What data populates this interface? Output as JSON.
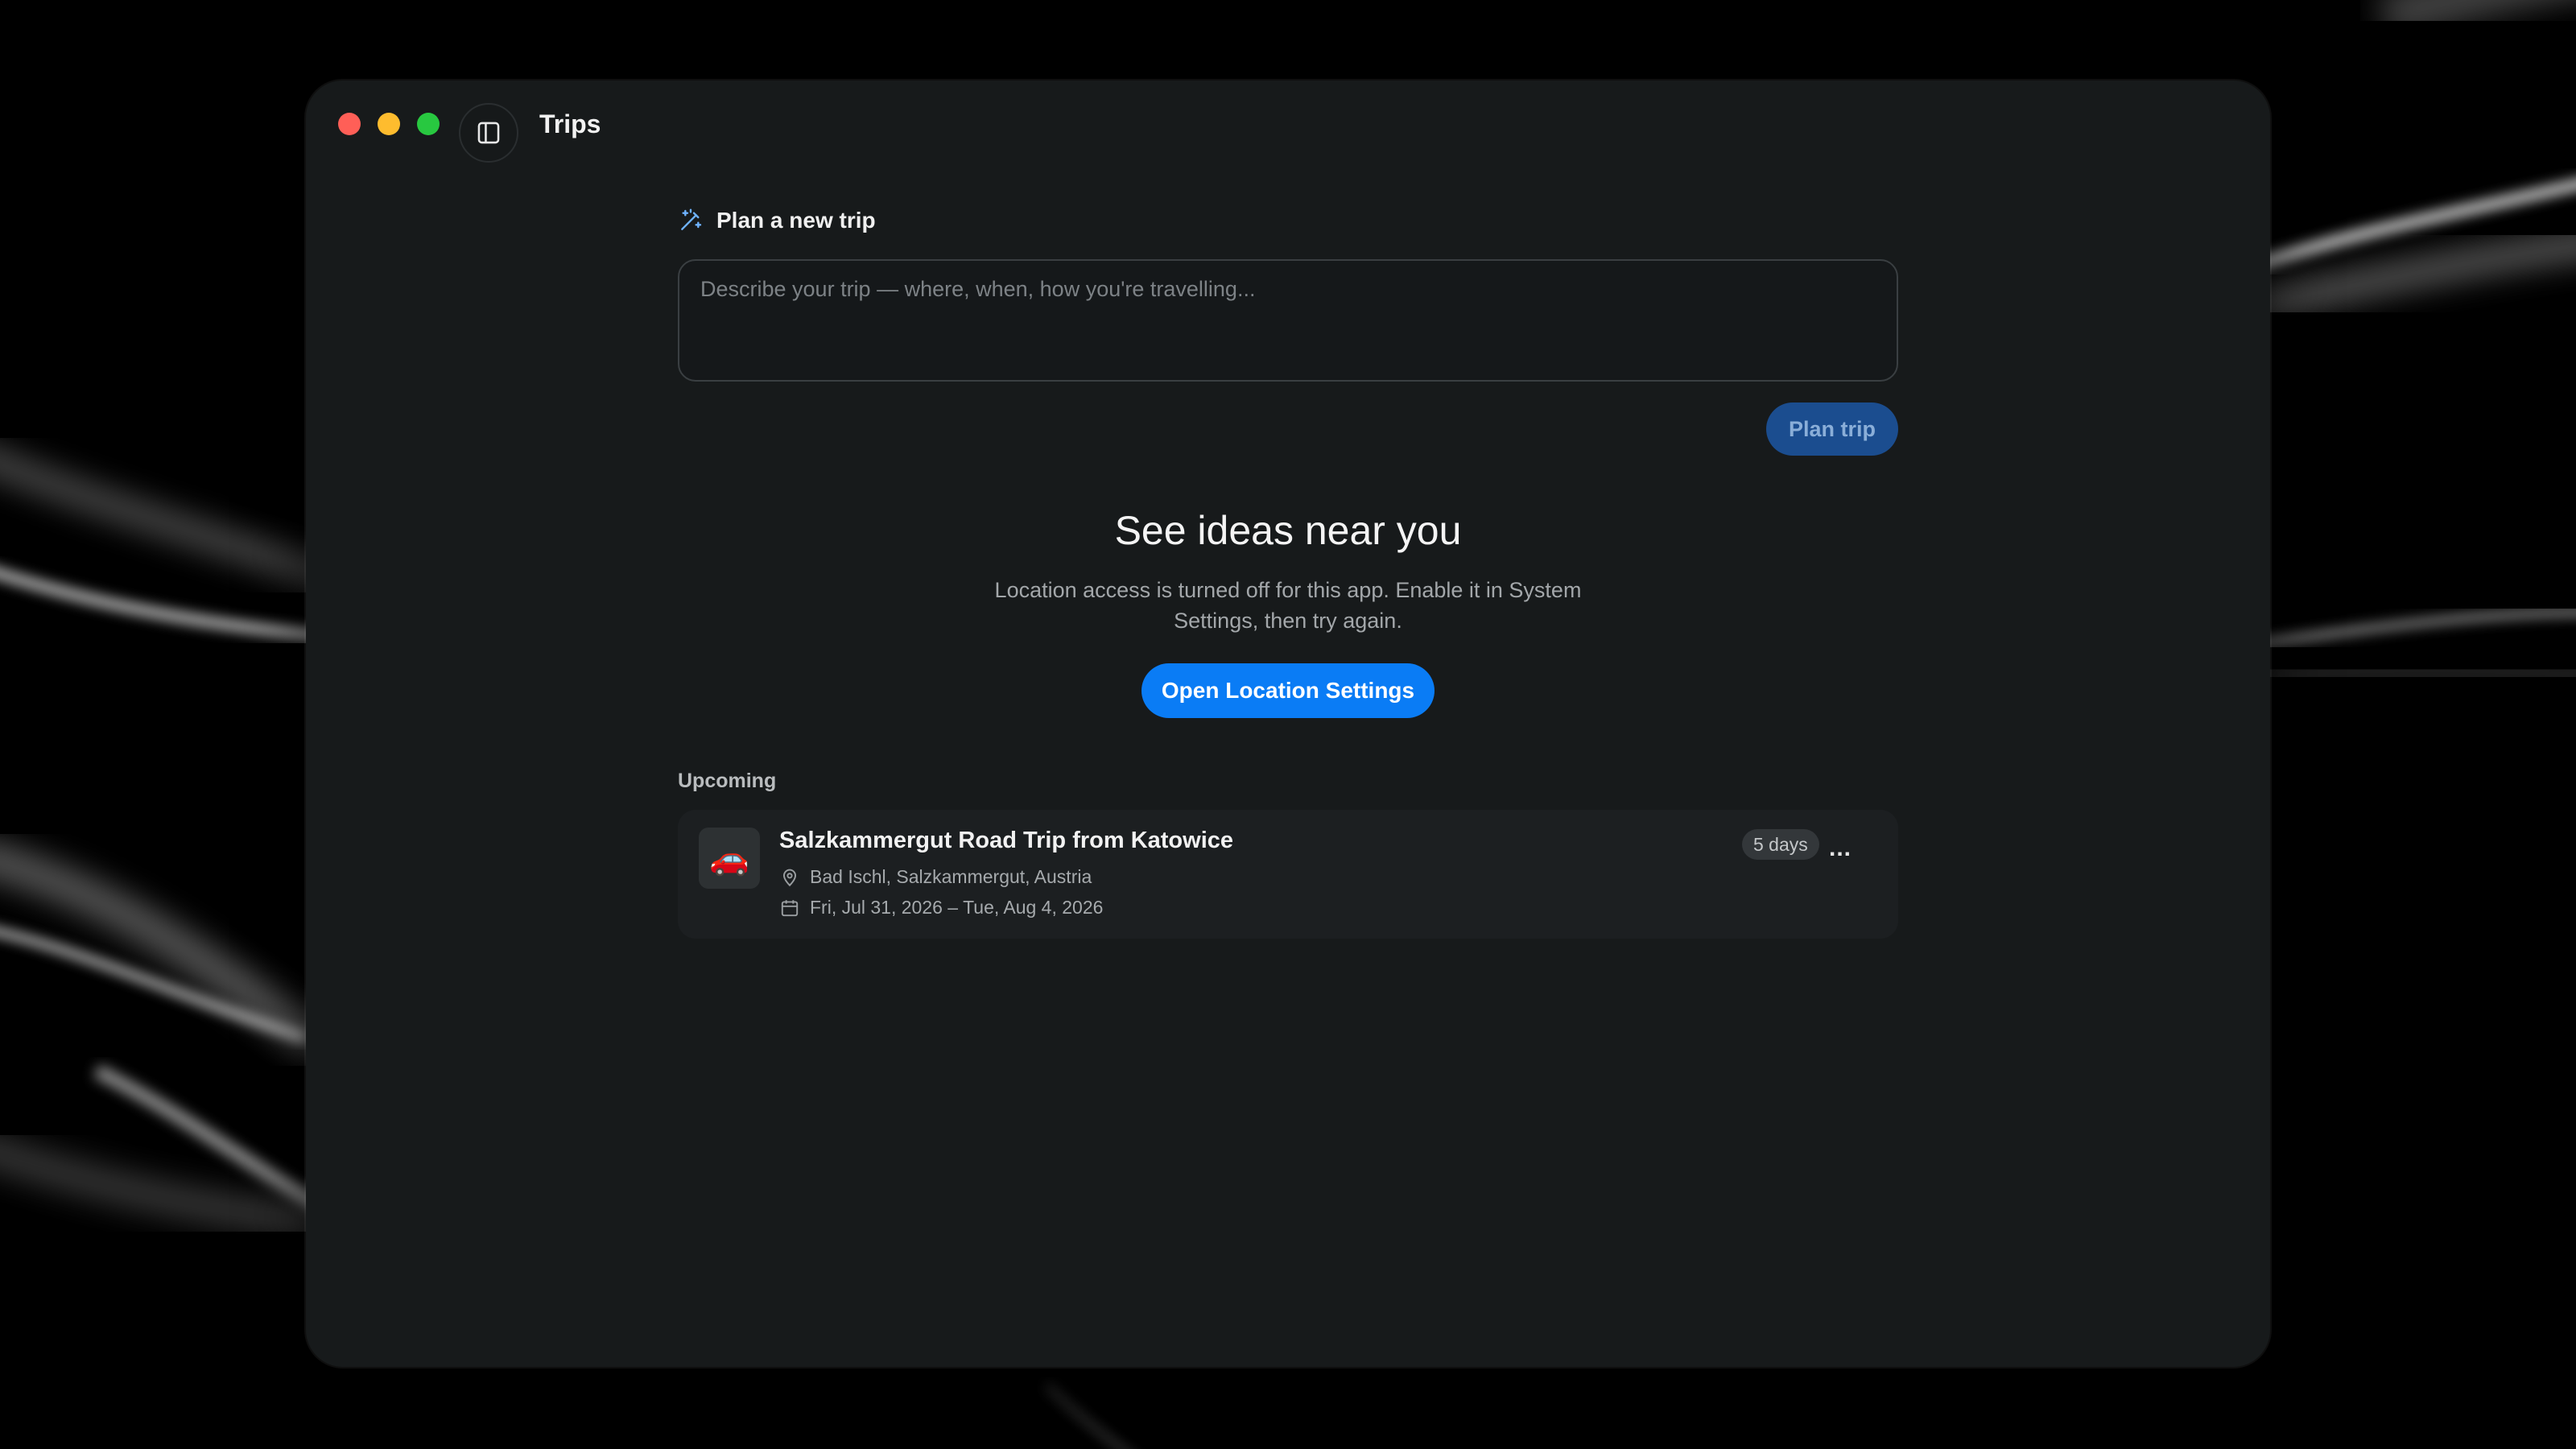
{
  "window": {
    "title": "Trips"
  },
  "plan": {
    "header_label": "Plan a new trip",
    "input_value": "",
    "input_placeholder": "Describe your trip — where, when, how you're travelling...",
    "button_label": "Plan trip"
  },
  "ideas": {
    "title": "See ideas near you",
    "description": "Location access is turned off for this app. Enable it in System Settings, then try again.",
    "button_label": "Open Location Settings"
  },
  "upcoming": {
    "section_label": "Upcoming",
    "trips": [
      {
        "emoji": "🚗",
        "title": "Salzkammergut Road Trip from Katowice",
        "location": "Bad Ischl, Salzkammergut, Austria",
        "dates": "Fri, Jul 31, 2026 – Tue, Aug 4, 2026",
        "duration_badge": "5 days",
        "more_label": "..."
      }
    ]
  },
  "colors": {
    "window_bg": "#171a1b",
    "accent_blue": "#0a7cf5",
    "plan_button_disabled": "#1b4d8f",
    "card_bg": "#1c1f21",
    "traffic_red": "#ff5f57",
    "traffic_yellow": "#febc2e",
    "traffic_green": "#28c840"
  },
  "icons": {
    "sidebar_toggle": "sidebar-toggle-icon",
    "plan_header": "magic-wand-icon",
    "location": "map-pin-icon",
    "calendar": "calendar-icon"
  }
}
